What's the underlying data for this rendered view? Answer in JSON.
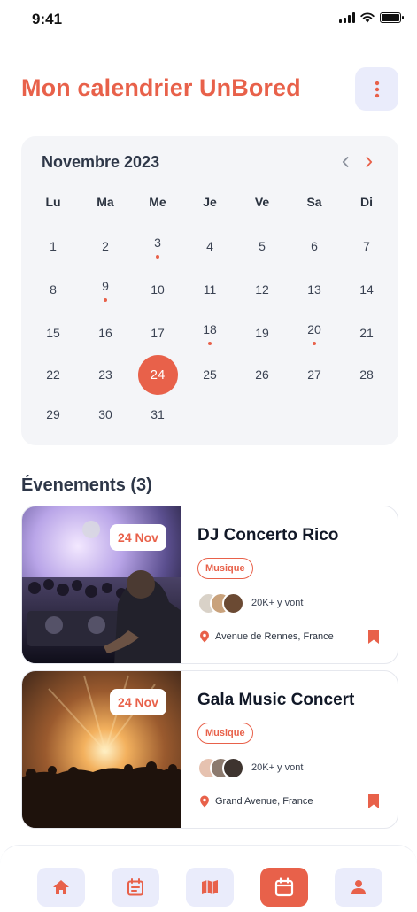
{
  "status_bar": {
    "time": "9:41"
  },
  "header": {
    "title": "Mon calendrier UnBored"
  },
  "calendar": {
    "month_label": "Novembre 2023",
    "weekdays": [
      "Lu",
      "Ma",
      "Me",
      "Je",
      "Ve",
      "Sa",
      "Di"
    ],
    "weeks": [
      [
        "1",
        "2",
        "3",
        "4",
        "5",
        "6",
        "7"
      ],
      [
        "8",
        "9",
        "10",
        "11",
        "12",
        "13",
        "14"
      ],
      [
        "15",
        "16",
        "17",
        "18",
        "19",
        "20",
        "21"
      ],
      [
        "22",
        "23",
        "24",
        "25",
        "26",
        "27",
        "28"
      ],
      [
        "29",
        "30",
        "31",
        "",
        "",
        "",
        ""
      ]
    ],
    "selected_day": "24",
    "event_days": [
      "3",
      "9",
      "18",
      "20"
    ]
  },
  "events": {
    "heading": "Évenements (3)",
    "items": [
      {
        "date": "24 Nov",
        "title": "DJ Concerto Rico",
        "tag": "Musique",
        "attendees": "20K+ y vont",
        "location": "Avenue de Rennes, France"
      },
      {
        "date": "24 Nov",
        "title": "Gala Music Concert",
        "tag": "Musique",
        "attendees": "20K+ y vont",
        "location": "Grand Avenue, France"
      }
    ]
  },
  "nav": {
    "items": [
      {
        "icon": "home-icon",
        "active": false
      },
      {
        "icon": "calendar-list-icon",
        "active": false
      },
      {
        "icon": "map-icon",
        "active": false
      },
      {
        "icon": "calendar-icon",
        "active": true
      },
      {
        "icon": "profile-icon",
        "active": false
      }
    ]
  },
  "colors": {
    "accent": "#e8614a",
    "soft": "#eaecfb",
    "surface": "#f4f5f8"
  }
}
